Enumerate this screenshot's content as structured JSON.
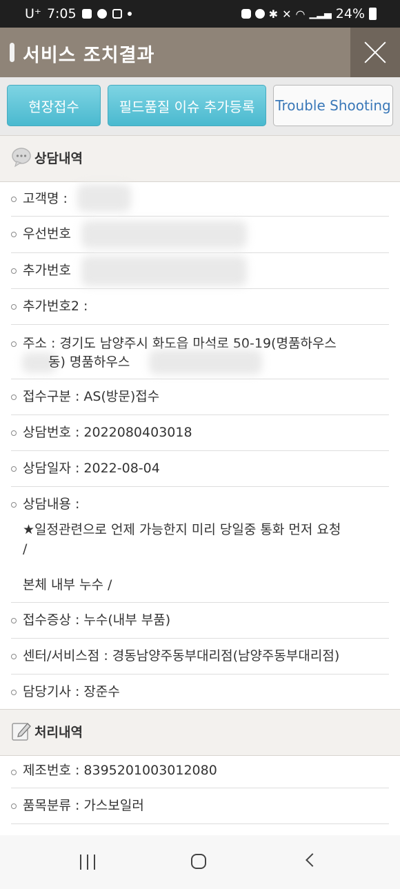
{
  "status_bar": {
    "carrier": "U⁺",
    "time": "7:05",
    "battery": "24%"
  },
  "header": {
    "title": "서비스 조치결과"
  },
  "buttons": {
    "field_receipt": "현장접수",
    "field_quality": "필드품질 이슈 추가등록",
    "trouble_shooting": "Trouble Shooting"
  },
  "consult_section": {
    "title": "상담내역",
    "customer_name": "고객명 :",
    "priority_number": "우선번호",
    "extra_number": "추가번호",
    "extra_number2": "추가번호2 :",
    "address_line1": "주소 : 경기도 남양주시 화도읍 마석로 50-19(명품하우스",
    "address_line2_a": "동) 명품하우스",
    "receipt_type": "접수구분 : AS(방문)접수",
    "consult_number": "상담번호 : 2022080403018",
    "consult_date": "상담일자 : 2022-08-04",
    "consult_content_label": "상담내용 :",
    "consult_content_line1": "★일정관련으로 언제 가능한지 미리 당일중 통화 먼저 요청",
    "consult_content_line2": "/",
    "consult_content_line3": "본체 내부 누수 /",
    "receipt_symptom": "접수증상 : 누수(내부 부품)",
    "service_center": "센터/서비스점 : 경동남양주동부대리점(남양주동부대리점)",
    "engineer": "담당기사 : 장준수"
  },
  "process_section": {
    "title": "처리내역",
    "serial_number": "제조번호 : 8395201003012080",
    "product_category": "품목분류 : 가스보일러"
  },
  "colors": {
    "title_bar": "#8f8478",
    "close_bg": "#6f655b",
    "button_blue": "#4ab9cf",
    "section_bg": "#f3f1ee"
  },
  "icons": {
    "consult": "speech-bubble-icon",
    "process": "edit-note-icon",
    "close": "close-icon"
  }
}
